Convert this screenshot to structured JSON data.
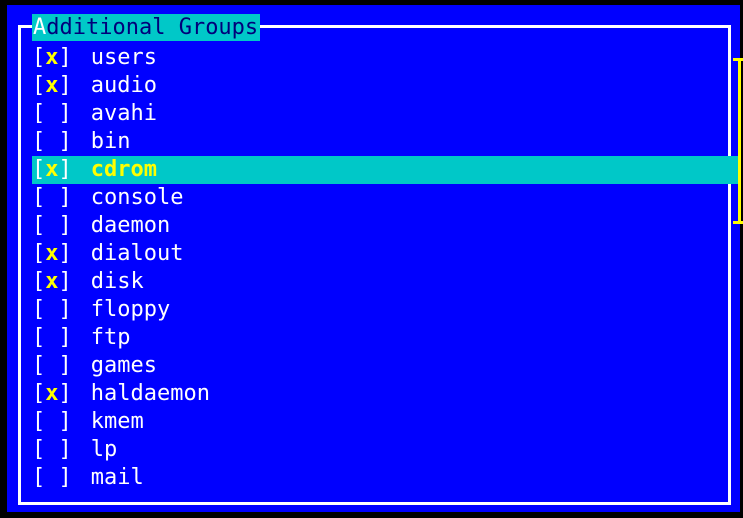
{
  "dialog": {
    "title_first": "A",
    "title_rest": "dditional Groups"
  },
  "groups": [
    {
      "checked": true,
      "mark": "x",
      "name": "users",
      "selected": false
    },
    {
      "checked": true,
      "mark": "x",
      "name": "audio",
      "selected": false
    },
    {
      "checked": false,
      "mark": " ",
      "name": "avahi",
      "selected": false
    },
    {
      "checked": false,
      "mark": " ",
      "name": "bin",
      "selected": false
    },
    {
      "checked": true,
      "mark": "x",
      "name": "cdrom",
      "selected": true
    },
    {
      "checked": false,
      "mark": " ",
      "name": "console",
      "selected": false
    },
    {
      "checked": false,
      "mark": " ",
      "name": "daemon",
      "selected": false
    },
    {
      "checked": true,
      "mark": "x",
      "name": "dialout",
      "selected": false
    },
    {
      "checked": true,
      "mark": "x",
      "name": "disk",
      "selected": false
    },
    {
      "checked": false,
      "mark": " ",
      "name": "floppy",
      "selected": false
    },
    {
      "checked": false,
      "mark": " ",
      "name": "ftp",
      "selected": false
    },
    {
      "checked": false,
      "mark": " ",
      "name": "games",
      "selected": false
    },
    {
      "checked": true,
      "mark": "x",
      "name": "haldaemon",
      "selected": false
    },
    {
      "checked": false,
      "mark": " ",
      "name": "kmem",
      "selected": false
    },
    {
      "checked": false,
      "mark": " ",
      "name": "lp",
      "selected": false
    },
    {
      "checked": false,
      "mark": " ",
      "name": "mail",
      "selected": false
    }
  ],
  "brackets": {
    "open": "[",
    "close": "]"
  },
  "colors": {
    "background": "#0000ff",
    "highlight": "#00c8c8",
    "checkmark": "#ffff00",
    "text": "#ffffff"
  }
}
